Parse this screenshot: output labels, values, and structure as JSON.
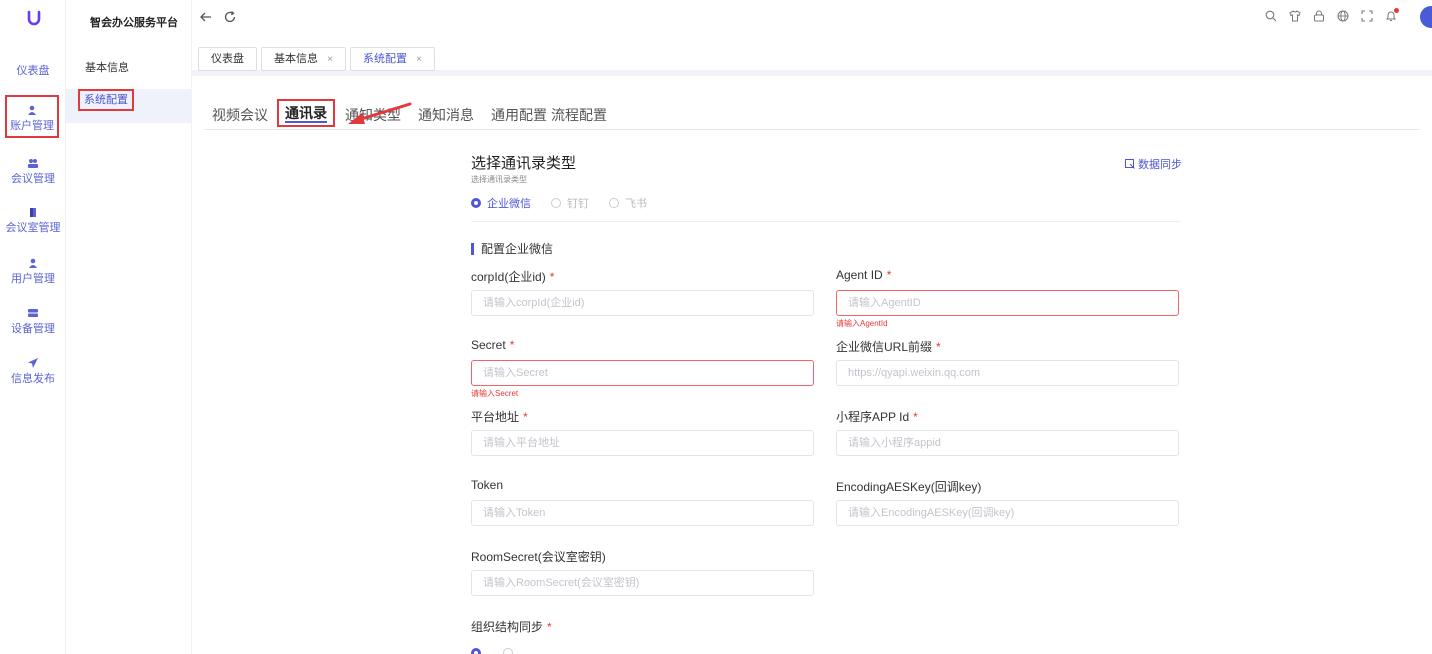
{
  "rail": {
    "items": [
      {
        "label": "仪表盘"
      },
      {
        "label": "账户管理"
      },
      {
        "label": "会议管理"
      },
      {
        "label": "会议室管理"
      },
      {
        "label": "用户管理"
      },
      {
        "label": "设备管理"
      },
      {
        "label": "信息发布"
      }
    ]
  },
  "app_title": "智会办公服务平台",
  "menu": {
    "items": [
      {
        "label": "基本信息"
      },
      {
        "label": "系统配置"
      }
    ]
  },
  "page_tabs": [
    {
      "label": "仪表盘"
    },
    {
      "label": "基本信息",
      "close": "×"
    },
    {
      "label": "系统配置",
      "close": "×"
    }
  ],
  "sub_tabs": [
    {
      "label": "视频会议"
    },
    {
      "label": "通讯录"
    },
    {
      "label": "通知类型"
    },
    {
      "label": "通知消息"
    },
    {
      "label": "通用配置"
    },
    {
      "label": "流程配置"
    }
  ],
  "section": {
    "title": "选择通讯录类型",
    "subtitle": "选择通讯录类型",
    "sync_label": "数据同步",
    "radios": [
      {
        "label": "企业微信",
        "selected": true
      },
      {
        "label": "钉钉",
        "selected": false
      },
      {
        "label": "飞书",
        "selected": false
      }
    ]
  },
  "config": {
    "title": "配置企业微信",
    "required_mark": "*",
    "fields": [
      {
        "label": "corpId(企业id)",
        "required": true,
        "placeholder": "请输入corpId(企业id)",
        "value": "",
        "error": ""
      },
      {
        "label": "Agent ID",
        "required": true,
        "placeholder": "请输入AgentID",
        "value": "",
        "error": "请输入AgentId"
      },
      {
        "label": "Secret",
        "required": true,
        "placeholder": "请输入Secret",
        "value": "",
        "error": "请输入Secret"
      },
      {
        "label": "企业微信URL前缀",
        "required": true,
        "placeholder": "https://qyapi.weixin.qq.com",
        "value": "",
        "error": ""
      },
      {
        "label": "平台地址",
        "required": true,
        "placeholder": "请输入平台地址",
        "value": "",
        "error": ""
      },
      {
        "label": "小程序APP Id",
        "required": true,
        "placeholder": "请输入小程序appid",
        "value": "",
        "error": ""
      },
      {
        "label": "Token",
        "required": false,
        "placeholder": "请输入Token",
        "value": "",
        "error": ""
      },
      {
        "label": "EncodingAESKey(回调key)",
        "required": false,
        "placeholder": "请输入EncodingAESKey(回调key)",
        "value": "",
        "error": ""
      },
      {
        "label": "RoomSecret(会议室密钥)",
        "required": false,
        "placeholder": "请输入RoomSecret(会议室密钥)",
        "value": "",
        "error": ""
      }
    ],
    "org_sync_label": "组织结构同步"
  },
  "colors": {
    "accent": "#4e56d3",
    "error": "#e53935",
    "highlight_box": "#e0393e"
  }
}
